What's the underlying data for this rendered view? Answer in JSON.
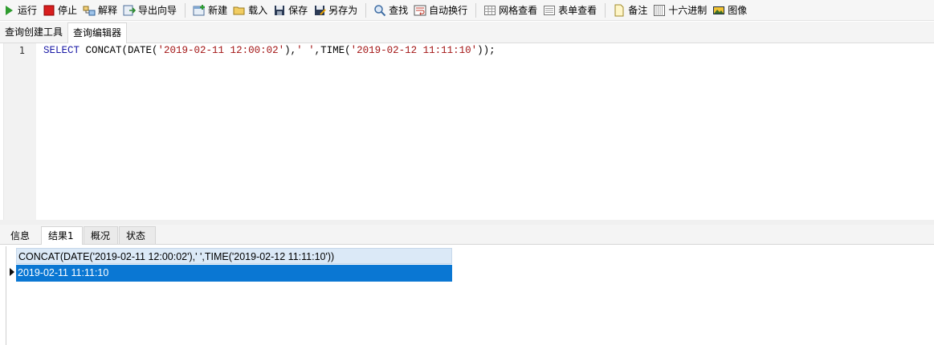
{
  "toolbar": {
    "run": "运行",
    "stop": "停止",
    "explain": "解释",
    "export_wizard": "导出向导",
    "new": "新建",
    "load": "载入",
    "save": "保存",
    "save_as": "另存为",
    "find": "查找",
    "word_wrap": "自动换行",
    "grid_view": "网格查看",
    "form_view": "表单查看",
    "memo": "备注",
    "hex": "十六进制",
    "image": "图像"
  },
  "editor_tabs": [
    "查询创建工具",
    "查询编辑器"
  ],
  "editor": {
    "line_number": "1",
    "code": {
      "kw": "SELECT",
      "p1": " CONCAT(DATE(",
      "s1": "'2019-02-11 12:00:02'",
      "p2": "),",
      "s2": "' '",
      "p3": ",TIME(",
      "s3": "'2019-02-12 11:11:10'",
      "p4": "));"
    }
  },
  "result_tabs": [
    "信息",
    "结果1",
    "概况",
    "状态"
  ],
  "grid": {
    "column_header": "CONCAT(DATE('2019-02-11 12:00:02'),' ',TIME('2019-02-12 11:11:10'))",
    "rows": [
      "2019-02-11 11:11:10"
    ]
  },
  "colors": {
    "keyword": "#1a1aa6",
    "string": "#a31515",
    "selected_row": "#0a77d3",
    "header_bg": "#dbe9f7"
  }
}
